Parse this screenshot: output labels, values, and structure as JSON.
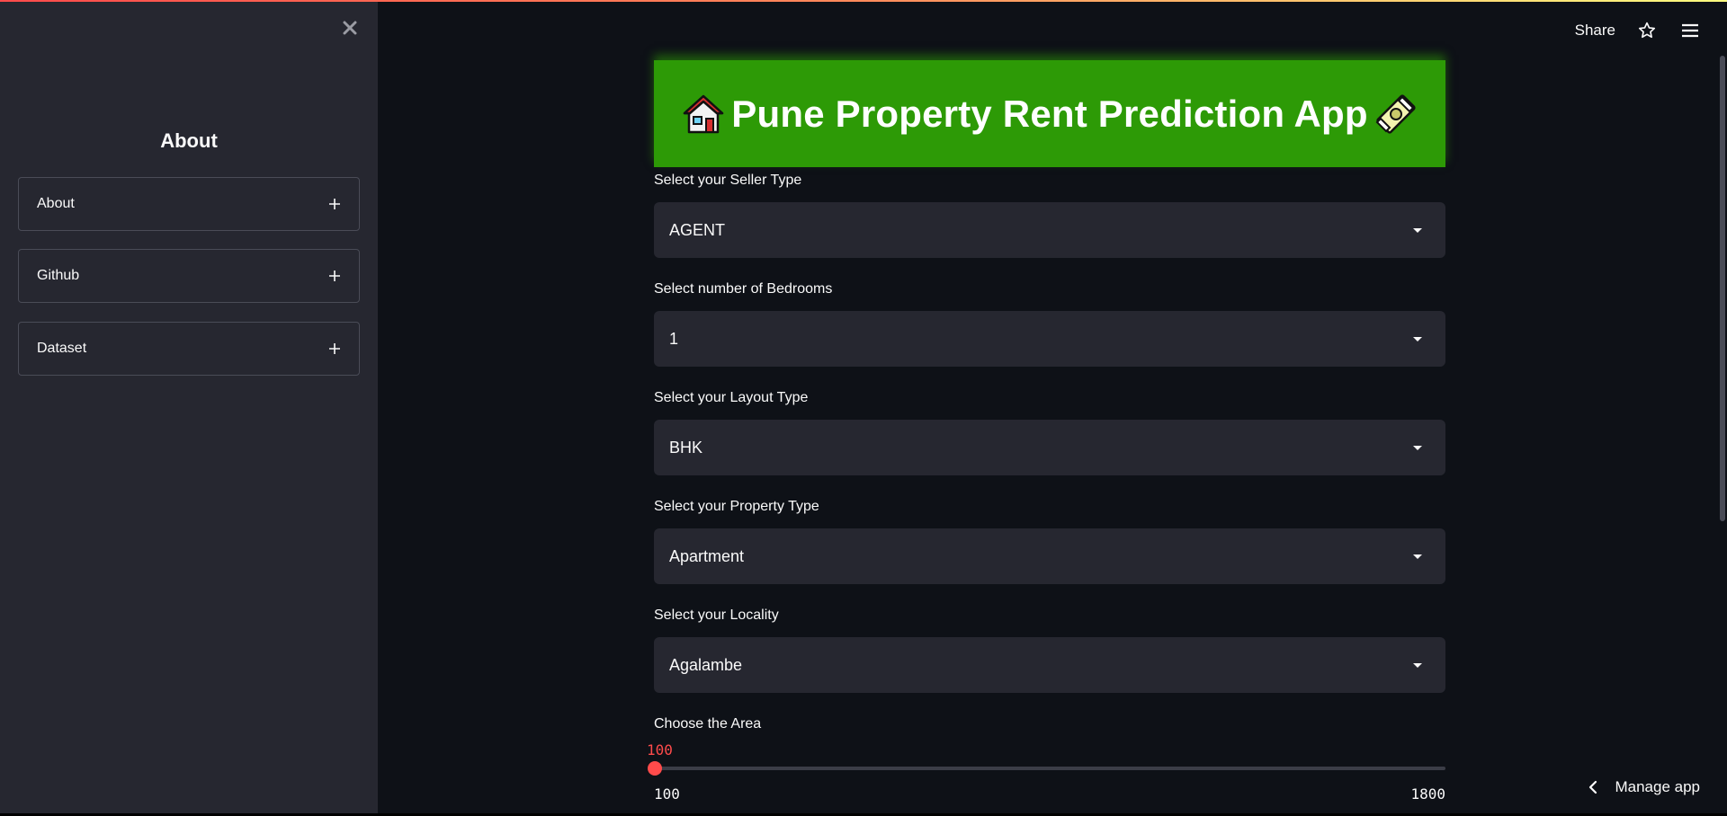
{
  "header": {
    "share_label": "Share",
    "icons": [
      "star-icon",
      "hamburger-menu-icon"
    ]
  },
  "sidebar": {
    "close_icon": "close-icon",
    "title": "About",
    "expanders": [
      {
        "label": "About",
        "icon": "plus-icon"
      },
      {
        "label": "Github",
        "icon": "plus-icon"
      },
      {
        "label": "Dataset",
        "icon": "plus-icon"
      }
    ]
  },
  "banner": {
    "title": "Pune Property Rent Prediction App",
    "left_icon": "house-icon",
    "right_icon": "money-icon",
    "color": "#2d9a06"
  },
  "form": {
    "seller_type": {
      "label": "Select your Seller Type",
      "value": "AGENT"
    },
    "bedrooms": {
      "label": "Select number of Bedrooms",
      "value": "1"
    },
    "layout_type": {
      "label": "Select your Layout Type",
      "value": "BHK"
    },
    "property_type": {
      "label": "Select your Property Type",
      "value": "Apartment"
    },
    "locality": {
      "label": "Select your Locality",
      "value": "Agalambe"
    },
    "area": {
      "label": "Choose the Area",
      "value": "100",
      "min": "100",
      "max": "1800",
      "fraction": 0
    }
  },
  "footer": {
    "manage_app_label": "Manage app",
    "icon": "chevron-left-icon"
  },
  "colors": {
    "background": "#0e1117",
    "sidebar": "#262730",
    "accent": "#ff4b4b"
  }
}
